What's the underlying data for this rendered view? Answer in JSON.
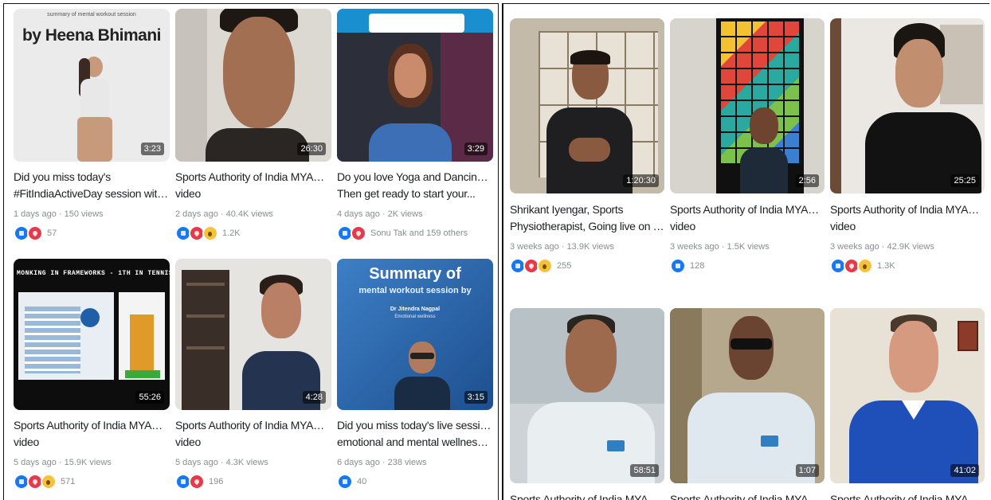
{
  "left_panel": {
    "videos": [
      {
        "thumb_text": "by Heena Bhimani",
        "thumb_caption": "summary of mental workout session",
        "duration": "3:23",
        "title_line1": "Did you miss today's",
        "title_line2": "#FitIndiaActiveDay session with...",
        "meta": "1 days ago · 150 views",
        "reactions": [
          "like",
          "love"
        ],
        "reaction_count": "57",
        "bg": "#e9e9ea"
      },
      {
        "duration": "26:30",
        "title_line1": "Sports Authority of India MYAS GOI's",
        "title_line2": "video",
        "meta": "2 days ago · 40.4K views",
        "reactions": [
          "like",
          "love",
          "wow"
        ],
        "reaction_count": "1.2K",
        "bg": "#d8d4cf"
      },
      {
        "duration": "3:29",
        "title_line1": "Do you love Yoga and Dancing? 😂",
        "title_line2": "Then get ready to start your...",
        "meta": "4 days ago · 2K views",
        "reactions": [
          "like",
          "love"
        ],
        "reaction_count": "Sonu Tak and 159 others",
        "bg": "#2b2e3a"
      },
      {
        "thumb_text": "MONKING IN FRAMEWORKS - 1TH IN TENNIS",
        "duration": "55:26",
        "title_line1": "Sports Authority of India MYAS GOI's",
        "title_line2": "video",
        "meta": "5 days ago · 15.9K views",
        "reactions": [
          "like",
          "love",
          "wow"
        ],
        "reaction_count": "571",
        "bg": "#101010"
      },
      {
        "duration": "4:28",
        "title_line1": "Sports Authority of India MYAS GOI's",
        "title_line2": "video",
        "meta": "5 days ago · 4.3K views",
        "reactions": [
          "like",
          "love"
        ],
        "reaction_count": "196",
        "bg": "#e4e2de"
      },
      {
        "thumb_text": "Summary of",
        "thumb_caption": "mental workout session by",
        "thumb_name": "Dr Jitendra Nagpal",
        "thumb_role": "Emotional wellness",
        "duration": "3:15",
        "title_line1": "Did you miss today's live session for",
        "title_line2": "emotional and mental wellness by D...",
        "meta": "6 days ago · 238 views",
        "reactions": [
          "like"
        ],
        "reaction_count": "40",
        "bg": "#2f6db3"
      }
    ]
  },
  "right_panel": {
    "videos": [
      {
        "duration": "1:20:30",
        "title_line1": "Shrikant Iyengar, Sports",
        "title_line2": "Physiotherapist, Going live on Topic...",
        "meta": "3 weeks ago · 13.9K views",
        "reactions": [
          "like",
          "love",
          "wow"
        ],
        "reaction_count": "255",
        "bg": "#bdb6a8"
      },
      {
        "duration": "2:56",
        "title_line1": "Sports Authority of India MYAS GOI's",
        "title_line2": "video",
        "meta": "3 weeks ago · 1.5K views",
        "reactions": [
          "like"
        ],
        "reaction_count": "128",
        "bg": "#1b1b1b"
      },
      {
        "duration": "25:25",
        "title_line1": "Sports Authority of India MYAS GOI's",
        "title_line2": "video",
        "meta": "3 weeks ago · 42.9K views",
        "reactions": [
          "like",
          "love",
          "wow"
        ],
        "reaction_count": "1.3K",
        "bg": "#e9e6e2"
      },
      {
        "duration": "58:51",
        "title_line1": "Sports Authority of India MYAS GOI's",
        "title_line2": "",
        "meta": "",
        "reactions": [],
        "reaction_count": "",
        "bg": "#cfd4d6"
      },
      {
        "duration": "1:07",
        "title_line1": "Sports Authority of India MYAS GOI's",
        "title_line2": "",
        "meta": "",
        "reactions": [],
        "reaction_count": "",
        "bg": "#b6a98f"
      },
      {
        "duration": "41:02",
        "title_line1": "Sports Authority of India MYAS GOI's",
        "title_line2": "",
        "meta": "",
        "reactions": [],
        "reaction_count": "",
        "bg": "#e7e1d6"
      }
    ]
  }
}
